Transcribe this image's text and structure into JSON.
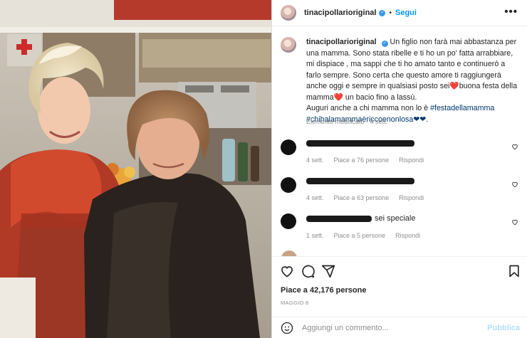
{
  "post": {
    "username": "tinacipollarioriginal",
    "follow_label": "Segui",
    "more_label": "•••",
    "dot": "•"
  },
  "caption": {
    "username": "tinacipollarioriginal",
    "line1": "Un figlio non farà mai abbastanza per una mamma. Sono stata ribelle e ti ho un po' fatta arrabbiare, mi dispiace , ma sappi che ti ho amato tanto e continuerò a farlo sempre. Sono certa che questo amore ti raggiungerà anche oggi e sempre in qualsiasi posto sei",
    "heart1": "❤️",
    "line2": "buona festa della mamma",
    "heart2": "❤️",
    "line3": " un bacio fino a lassù.",
    "line4": "Auguri anche a chi mamma non lo è ",
    "hashtag1": "#festadellamamma",
    "hashtag2": "#chihalamammaèriccoenonlosa",
    "hearts_end": "❤❤.",
    "edited": "Elemento modificato",
    "time": "4 sett."
  },
  "comments": [
    {
      "text": "",
      "time": "4 sett.",
      "likes": "Piace a 76 persone",
      "reply": "Rispondi"
    },
    {
      "text": "",
      "time": "4 sett.",
      "likes": "Piace a 63 persone",
      "reply": "Rispondi"
    },
    {
      "text": "sei speciale",
      "time": "1 sett.",
      "likes": "Piace a 5 persone",
      "reply": "Rispondi"
    }
  ],
  "actions": {
    "likes": "Piace a 42,176 persone",
    "date": "MAGGIO 8"
  },
  "add_comment": {
    "placeholder": "Aggiungi un commento...",
    "publish": "Pubblica"
  },
  "colors": {
    "accent": "#0095f6",
    "verified": "#3897f0",
    "heart": "#ed4956"
  }
}
